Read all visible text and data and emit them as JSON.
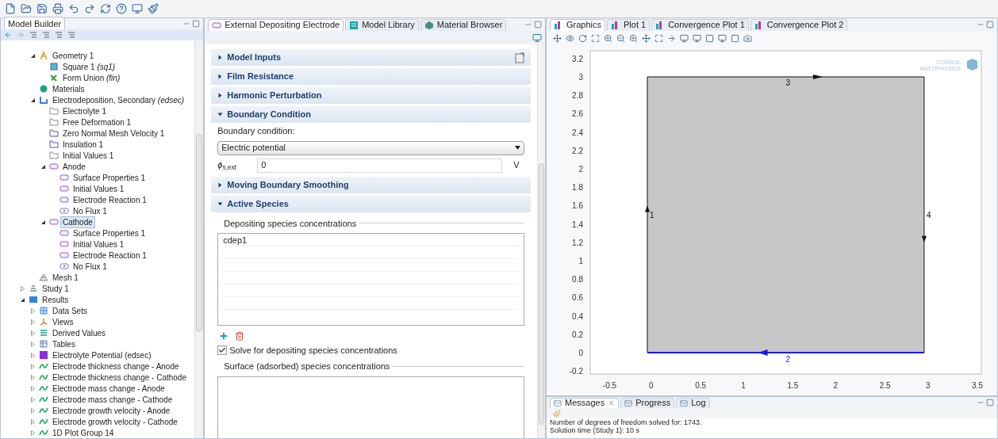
{
  "model_builder": {
    "title": "Model Builder",
    "scrolled_items": [
      {
        "label": "Geometry 1",
        "kind": "geometry",
        "expanded": true,
        "selected": false,
        "children": [
          {
            "label": "Square 1 *(sq1)*",
            "kind": "square",
            "selected": false
          },
          {
            "label": "Form Union *(fin)*",
            "kind": "union",
            "selected": false
          }
        ]
      },
      {
        "label": "Materials",
        "kind": "materials",
        "selected": false
      },
      {
        "label": "Electrodeposition, Secondary *(edsec)*",
        "kind": "physics",
        "expanded": true,
        "selected": false,
        "children": [
          {
            "label": "Electrolyte 1",
            "kind": "domain",
            "selected": false
          },
          {
            "label": "Free Deformation 1",
            "kind": "domain",
            "selected": false
          },
          {
            "label": "Zero Normal Mesh Velocity 1",
            "kind": "boundary",
            "selected": false
          },
          {
            "label": "Insulation 1",
            "kind": "boundary",
            "selected": false
          },
          {
            "label": "Initial Values 1",
            "kind": "domain",
            "selected": false
          },
          {
            "label": "Anode",
            "kind": "electrode",
            "expanded": true,
            "selected": false,
            "children": [
              {
                "label": "Surface Properties 1",
                "kind": "electrode",
                "selected": false
              },
              {
                "label": "Initial Values 1",
                "kind": "electrode",
                "selected": false
              },
              {
                "label": "Electrode Reaction 1",
                "kind": "electrode",
                "selected": false
              },
              {
                "label": "No Flux 1",
                "kind": "noflux",
                "selected": false
              }
            ]
          },
          {
            "label": "Cathode",
            "kind": "electrode",
            "expanded": true,
            "selected": true,
            "children": [
              {
                "label": "Surface Properties 1",
                "kind": "electrode",
                "selected": false
              },
              {
                "label": "Initial Values 1",
                "kind": "electrode",
                "selected": false
              },
              {
                "label": "Electrode Reaction 1",
                "kind": "electrode",
                "selected": false
              },
              {
                "label": "No Flux 1",
                "kind": "noflux",
                "selected": false
              }
            ]
          }
        ]
      },
      {
        "label": "Mesh 1",
        "kind": "mesh",
        "selected": false
      }
    ],
    "items": [
      {
        "label": "Study 1",
        "kind": "study",
        "expanded": false,
        "selected": false
      },
      {
        "label": "Results",
        "kind": "results",
        "expanded": true,
        "selected": false,
        "children": [
          {
            "label": "Data Sets",
            "kind": "datasets",
            "expanded": false,
            "selected": false
          },
          {
            "label": "Views",
            "kind": "views",
            "expanded": false,
            "selected": false
          },
          {
            "label": "Derived Values",
            "kind": "derived",
            "expanded": false,
            "selected": false
          },
          {
            "label": "Tables",
            "kind": "tables",
            "expanded": false,
            "selected": false
          },
          {
            "label": "Electrolyte Potential (edsec)",
            "kind": "plot2d",
            "expanded": false,
            "selected": false
          },
          {
            "label": "Electrode thickness change - Anode",
            "kind": "plot1d",
            "expanded": false,
            "selected": false
          },
          {
            "label": "Electrode thickness change - Cathode",
            "kind": "plot1d",
            "expanded": false,
            "selected": false
          },
          {
            "label": "Electrode mass change - Anode",
            "kind": "plot1d",
            "expanded": false,
            "selected": false
          },
          {
            "label": "Electrode mass change - Cathode",
            "kind": "plot1d",
            "expanded": false,
            "selected": false
          },
          {
            "label": "Electrode growth velocity - Anode",
            "kind": "plot1d",
            "expanded": false,
            "selected": false
          },
          {
            "label": "Electrode growth velocity - Cathode",
            "kind": "plot1d",
            "expanded": false,
            "selected": false
          },
          {
            "label": "1D Plot Group 14",
            "kind": "plot1d",
            "expanded": false,
            "selected": false
          }
        ]
      }
    ]
  },
  "settings": {
    "tabs": [
      {
        "label": "External Depositing Electrode",
        "kind": "electrode",
        "selected": true
      },
      {
        "label": "Model Library",
        "kind": "library",
        "selected": false
      },
      {
        "label": "Material Browser",
        "kind": "material",
        "selected": false
      }
    ],
    "sections": [
      {
        "title": "Model Inputs",
        "expanded": false
      },
      {
        "title": "Film Resistance",
        "expanded": false
      },
      {
        "title": "Harmonic Perturbation",
        "expanded": false
      },
      {
        "title": "Boundary Condition",
        "kind": "boundary",
        "expanded": true,
        "label": "Boundary condition:",
        "select_value": "Electric potential",
        "variable": "ϕ$_{s,ext}$",
        "value": "0",
        "unit": "V"
      },
      {
        "title": "Moving Boundary Smoothing",
        "expanded": false
      },
      {
        "title": "Active Species",
        "kind": "species",
        "expanded": true,
        "depositing_legend": "Depositing species concentrations",
        "depositing_rows": [
          "cdep1"
        ],
        "solve": {
          "label": "Solve for depositing species concentrations",
          "checked": true
        },
        "surface_legend": "Surface (adsorbed) species concentrations"
      }
    ]
  },
  "graphics": {
    "tabs": [
      {
        "label": "Graphics",
        "selected": true
      },
      {
        "label": "Plot 1",
        "selected": false
      },
      {
        "label": "Convergence Plot 1",
        "selected": false
      },
      {
        "label": "Convergence Plot 2",
        "selected": false
      }
    ],
    "logo": [
      "COMSOL",
      "MULTIPHYSICS"
    ],
    "y_ticks": [
      "3.2",
      "3",
      "2.8",
      "2.6",
      "2.4",
      "2.2",
      "2",
      "1.8",
      "1.6",
      "1.4",
      "1.2",
      "1",
      "0.8",
      "0.6",
      "0.4",
      "0.2",
      "0",
      "-0.2"
    ],
    "x_ticks": [
      "-0.5",
      "0",
      "0.5",
      "1",
      "1.5",
      "2",
      "2.5",
      "3",
      "3.5"
    ],
    "edges": [
      {
        "label": "1",
        "selected": false
      },
      {
        "label": "2",
        "selected": true
      },
      {
        "label": "3",
        "selected": false
      },
      {
        "label": "4",
        "selected": false
      }
    ]
  },
  "messages": {
    "tabs": [
      {
        "label": "Messages",
        "selected": true
      },
      {
        "label": "Progress",
        "selected": false
      },
      {
        "label": "Log",
        "selected": false
      }
    ],
    "lines": [
      "Number of degrees of freedom solved for: 1743.",
      "Solution time (Study 1): 10 s"
    ]
  }
}
